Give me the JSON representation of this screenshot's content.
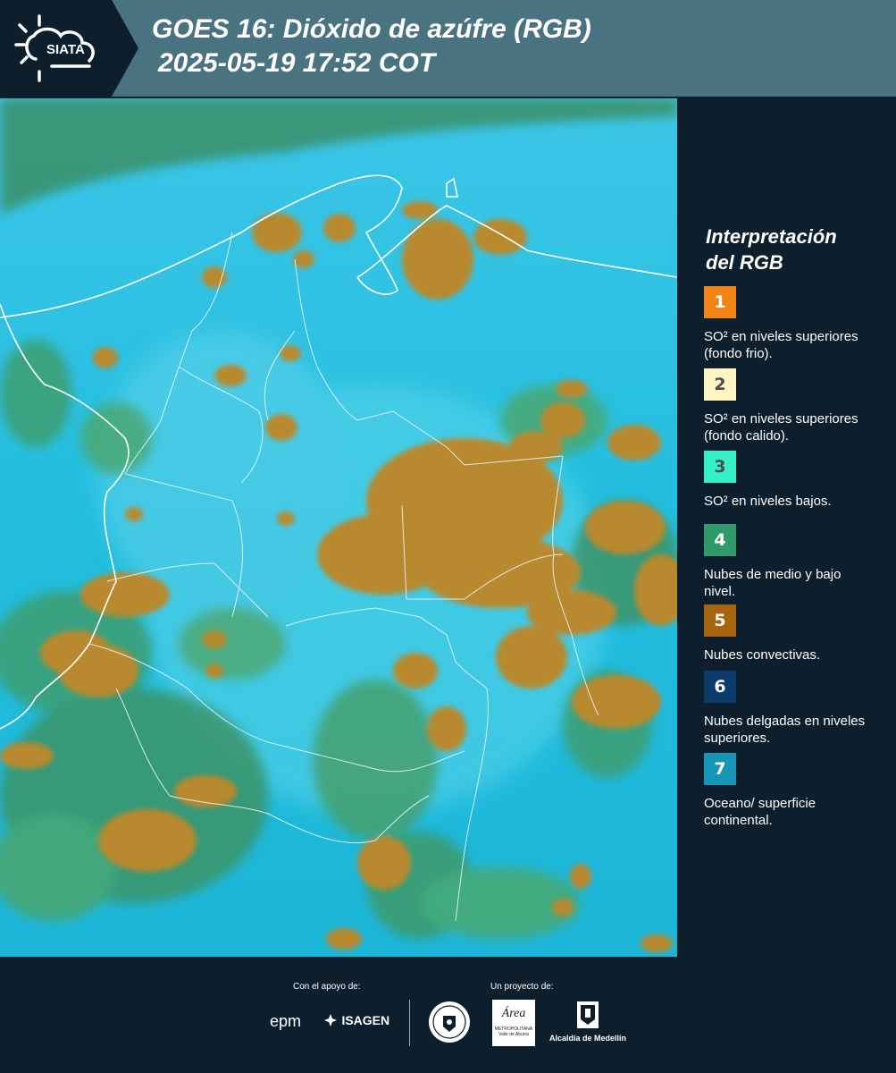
{
  "header": {
    "logo_text": "SIATA",
    "title_line1": "GOES 16: Dióxido de azúfre (RGB)",
    "title_line2": "2025-05-19 17:52 COT"
  },
  "legend": {
    "title_line1": "Interpretación",
    "title_line2": "del RGB",
    "items": [
      {
        "number": "1",
        "color": "#f28318",
        "number_color": "#ffffff",
        "text": "SO² en niveles superiores (fondo frio)."
      },
      {
        "number": "2",
        "color": "#fcf4c1",
        "number_color": "#4d4d4d",
        "text": "SO² en niveles superiores (fondo calido)."
      },
      {
        "number": "3",
        "color": "#35f0c4",
        "number_color": "#4d4d4d",
        "text": "SO² en niveles bajos."
      },
      {
        "number": "4",
        "color": "#319a6a",
        "number_color": "#ffffff",
        "text": "Nubes de medio y bajo nivel."
      },
      {
        "number": "5",
        "color": "#a7650f",
        "number_color": "#ffffff",
        "text": "Nubes convectivas."
      },
      {
        "number": "6",
        "color": "#0c3a6b",
        "number_color": "#ffffff",
        "text": "Nubes delgadas en niveles superiores."
      },
      {
        "number": "7",
        "color": "#1795b7",
        "number_color": "#ffffff",
        "text": "Oceano/ superficie continental."
      }
    ]
  },
  "footer": {
    "support_label": "Con el apoyo de:",
    "project_label": "Un proyecto de:",
    "sponsors": [
      "epm",
      "ISAGEN"
    ],
    "project_logos": [
      "Área Metropolitana Valle de Aburrá",
      "Alcaldía de Medellín"
    ],
    "area_logo_word": "Área",
    "area_logo_sub1": "METROPOLITANA",
    "area_logo_sub2": "Valle de Aburrá",
    "alcaldia_label": "Alcaldía de Medellín"
  },
  "colors": {
    "header_bg": "#4a7382",
    "panel_bg": "#0d1e2c",
    "ocean": "#26c0e0",
    "cloud_convective": "#b8892e",
    "cloud_low": "#3e9e6f"
  }
}
